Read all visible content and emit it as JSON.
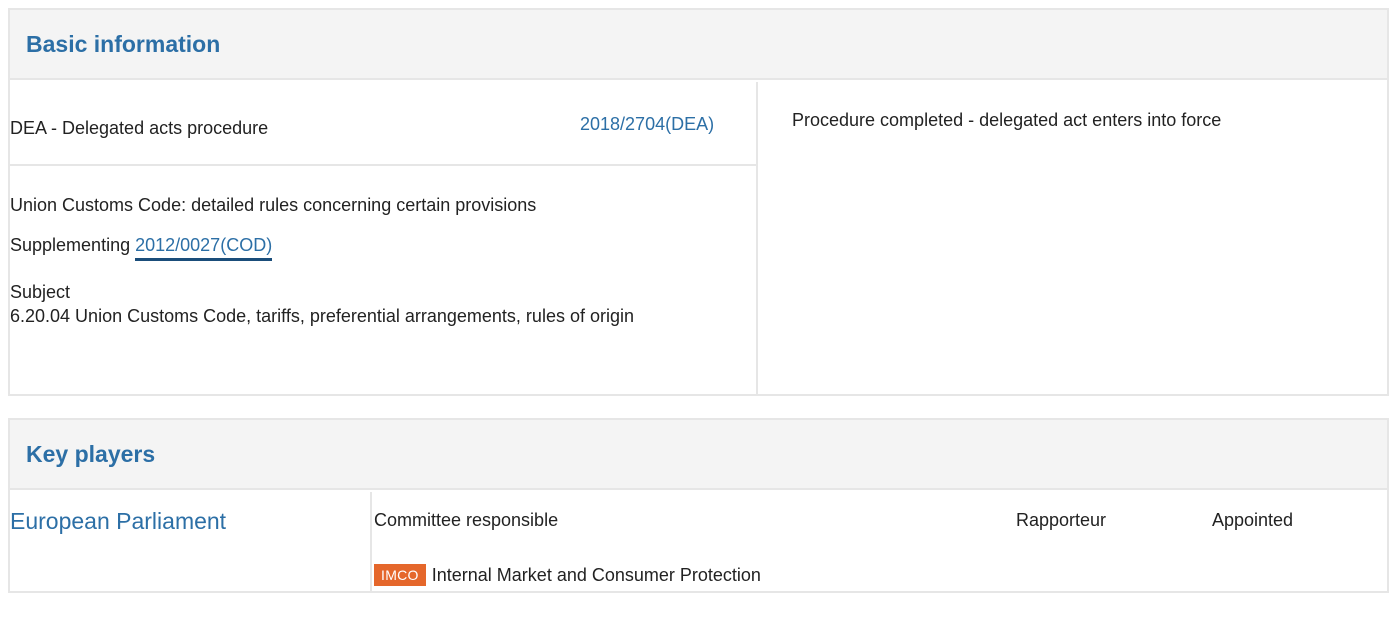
{
  "basic_information": {
    "title": "Basic information",
    "procedure_type": "DEA - Delegated acts procedure",
    "procedure_reference": "2018/2704(DEA)",
    "procedure_title": "Union Customs Code: detailed rules concerning certain provisions",
    "supplementing_label": "Supplementing",
    "supplementing_reference": "2012/0027(COD)",
    "subject_label": "Subject",
    "subject_text": "6.20.04 Union Customs Code, tariffs, preferential arrangements, rules of origin",
    "status": "Procedure completed - delegated act enters into force"
  },
  "key_players": {
    "title": "Key players",
    "institution": "European Parliament",
    "columns": {
      "committee": "Committee responsible",
      "rapporteur": "Rapporteur",
      "appointed": "Appointed"
    },
    "rows": [
      {
        "committee_code": "IMCO",
        "committee_name": "Internal Market and Consumer Protection",
        "rapporteur": "",
        "appointed": ""
      }
    ],
    "colors": {
      "badge": "#e5672b",
      "link": "#2c6fa6"
    }
  }
}
